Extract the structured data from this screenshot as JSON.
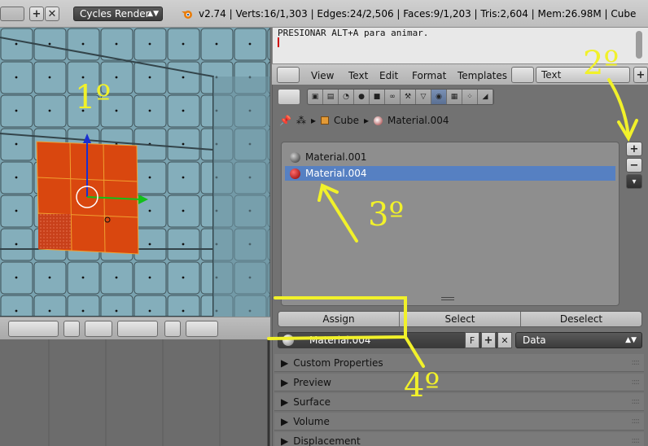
{
  "info": {
    "render_engine": "Cycles Render",
    "stats": "v2.74 | Verts:16/1,303 | Edges:24/2,506 | Faces:9/1,203 | Tris:2,604 | Mem:26.98M | Cube"
  },
  "text_editor": {
    "content": "PRESIONAR ALT+A para animar.",
    "menus": [
      "View",
      "Text",
      "Edit",
      "Format",
      "Templates"
    ],
    "datablock_name": "Text"
  },
  "properties": {
    "breadcrumb": {
      "object": "Cube",
      "material": "Material.004"
    },
    "material_slots": [
      {
        "name": "Material.001",
        "color": "#4a4a4a",
        "selected": false
      },
      {
        "name": "Material.004",
        "color": "#c01010",
        "selected": true
      }
    ],
    "slot_buttons": {
      "add": "+",
      "remove": "−",
      "menu": "▾"
    },
    "actions": {
      "assign": "Assign",
      "select": "Select",
      "deselect": "Deselect"
    },
    "material_field": {
      "name": "Material.004",
      "fake_user": "F",
      "link_type": "Data"
    },
    "panels": [
      "Custom Properties",
      "Preview",
      "Surface",
      "Volume",
      "Displacement"
    ]
  },
  "annotations": [
    "1º",
    "2º",
    "3º",
    "4º"
  ],
  "colors": {
    "selected_faces": "#d9470f",
    "mesh": "#7aa3b0",
    "selection": "#5680c2",
    "annotation": "#f1f12a"
  }
}
